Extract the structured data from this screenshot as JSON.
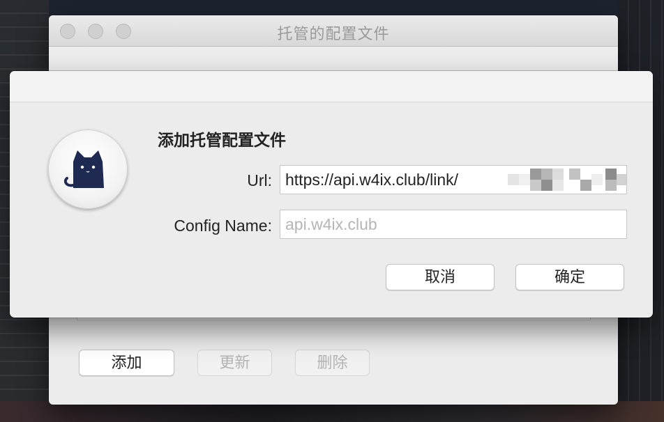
{
  "background_window": {
    "title": "托管的配置文件",
    "buttons": {
      "add": "添加",
      "update": "更新",
      "delete": "删除"
    }
  },
  "dialog": {
    "title": "添加托管配置文件",
    "url_label": "Url:",
    "url_value": "https://api.w4ix.club/link/",
    "config_name_label": "Config Name:",
    "config_name_placeholder": "api.w4ix.club",
    "cancel": "取消",
    "ok": "确定"
  },
  "icons": {
    "app": "black-cat-icon"
  }
}
